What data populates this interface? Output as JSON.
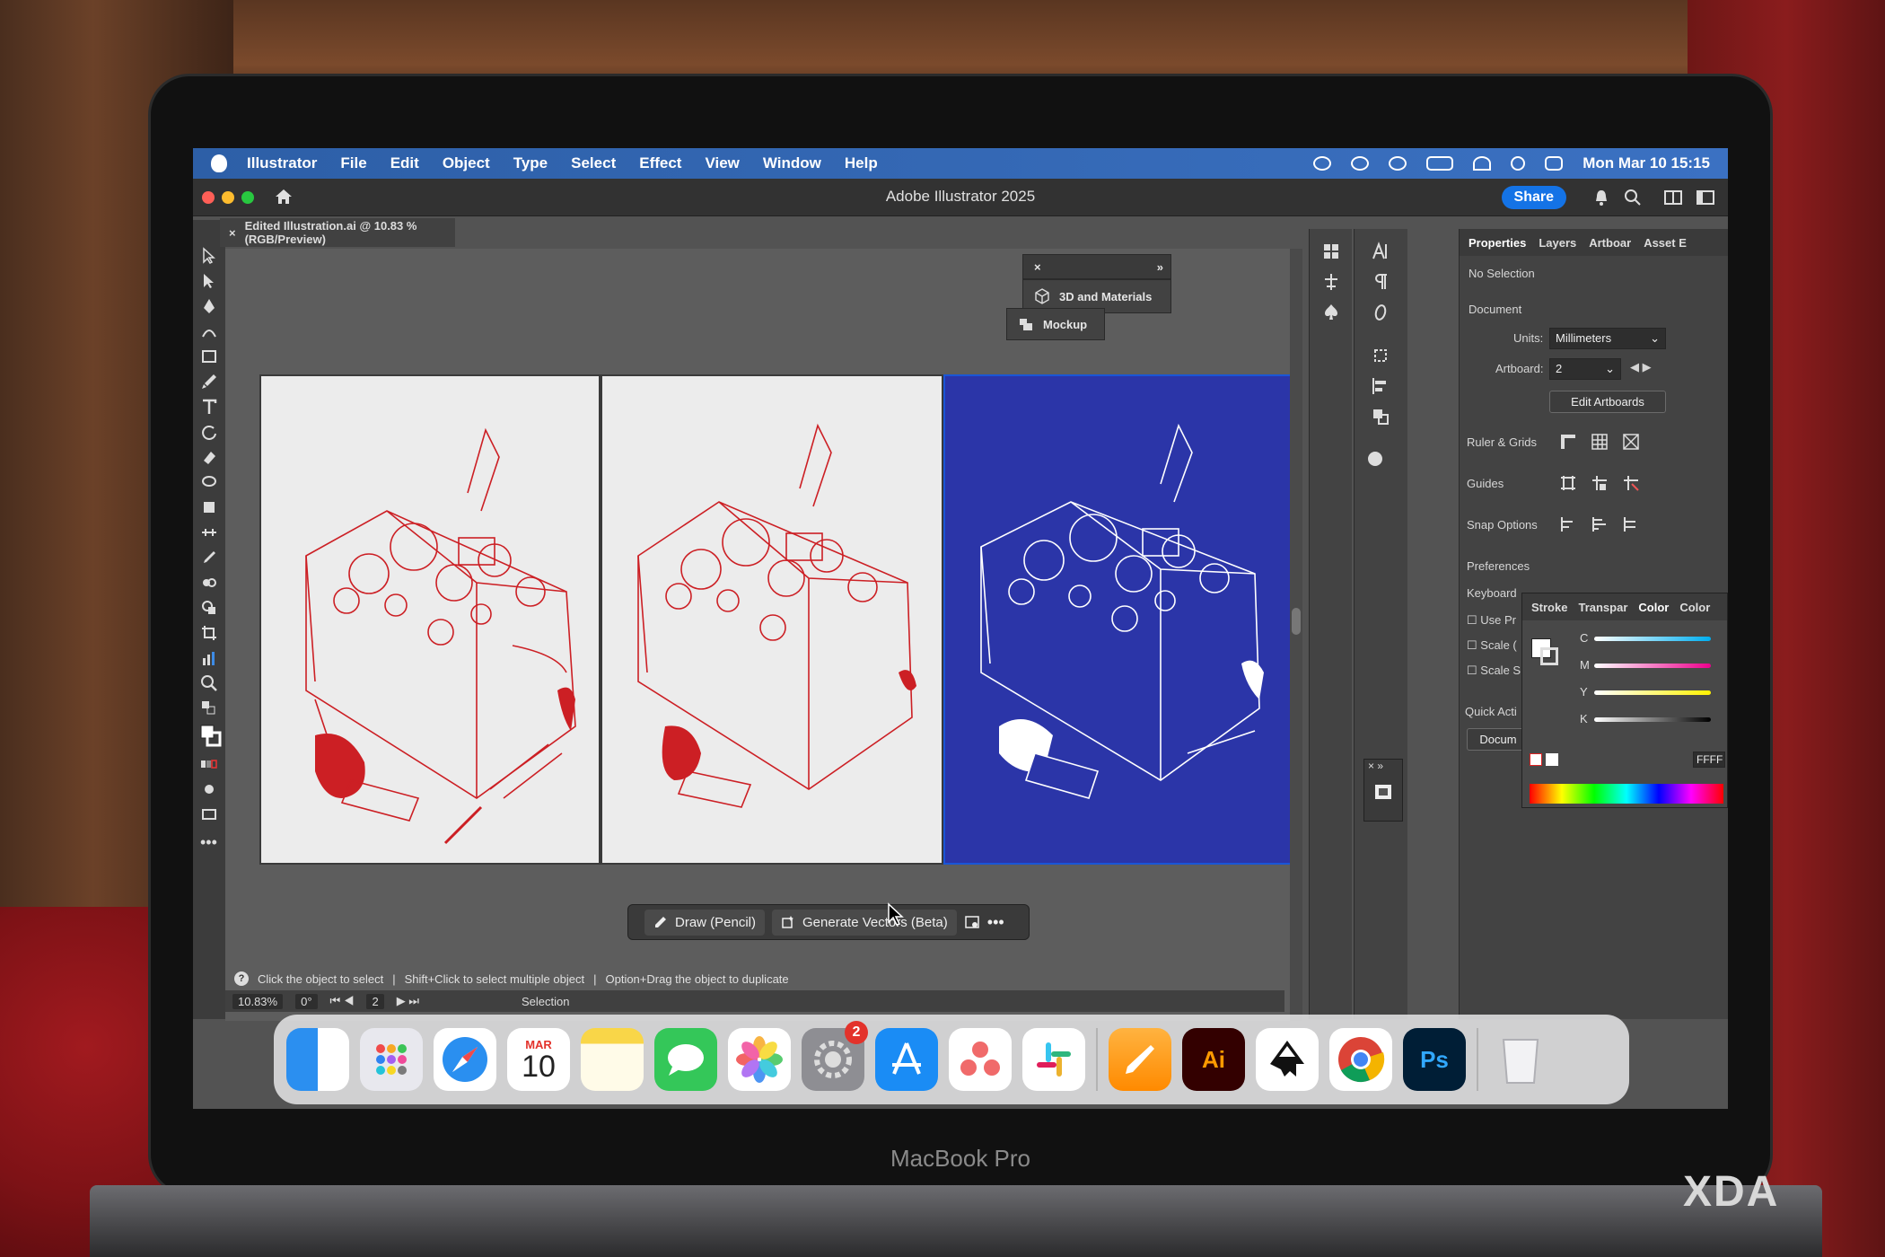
{
  "menubar": {
    "app_name": "Illustrator",
    "menus": [
      "File",
      "Edit",
      "Object",
      "Type",
      "Select",
      "Effect",
      "View",
      "Window",
      "Help"
    ],
    "datetime": "Mon Mar 10  15:15"
  },
  "titlebar": {
    "title": "Adobe Illustrator 2025",
    "share_label": "Share"
  },
  "document": {
    "tab_label": "Edited Illustration.ai @ 10.83 % (RGB/Preview)"
  },
  "floating_panels": {
    "materials_label": "3D and Materials",
    "mockup_label": "Mockup"
  },
  "context_bar": {
    "draw_label": "Draw (Pencil)",
    "generate_label": "Generate Vectors (Beta)"
  },
  "status": {
    "hint_part1": "Click the object to select",
    "hint_part2": "Shift+Click to select multiple object",
    "hint_part3": "Option+Drag the object to duplicate",
    "zoom": "10.83%",
    "rotation": "0°",
    "artboard_num": "2",
    "tool_name": "Selection"
  },
  "properties": {
    "tabs": [
      "Properties",
      "Layers",
      "Artboar",
      "Asset E"
    ],
    "selection": "No Selection",
    "document_heading": "Document",
    "units_label": "Units:",
    "units_value": "Millimeters",
    "artboard_label": "Artboard:",
    "artboard_value": "2",
    "edit_artboards": "Edit Artboards",
    "ruler_grids": "Ruler & Grids",
    "guides": "Guides",
    "snap_options": "Snap Options",
    "preferences": "Preferences",
    "keyboard": "Keyboard",
    "use_pr": "Use Pr",
    "scale_1": "Scale (",
    "scale_2": "Scale S",
    "quick_actions": "Quick Acti",
    "docu_btn": "Docum"
  },
  "color_panel": {
    "tabs": [
      "Stroke",
      "Transpar",
      "Color",
      "Color"
    ],
    "channels": [
      "C",
      "M",
      "Y",
      "K"
    ],
    "hex": "FFFF"
  },
  "dock": {
    "calendar_month": "MAR",
    "calendar_day": "10",
    "settings_badge": "2",
    "ai_label": "Ai",
    "ps_label": "Ps"
  },
  "hardware": {
    "brand": "MacBook Pro",
    "watermark": "XDA"
  },
  "colors": {
    "menubar": "#3b71c2",
    "artboard_blue": "#2b35a8",
    "illustration_red": "#cc1f24",
    "share_blue": "#1473e6"
  }
}
